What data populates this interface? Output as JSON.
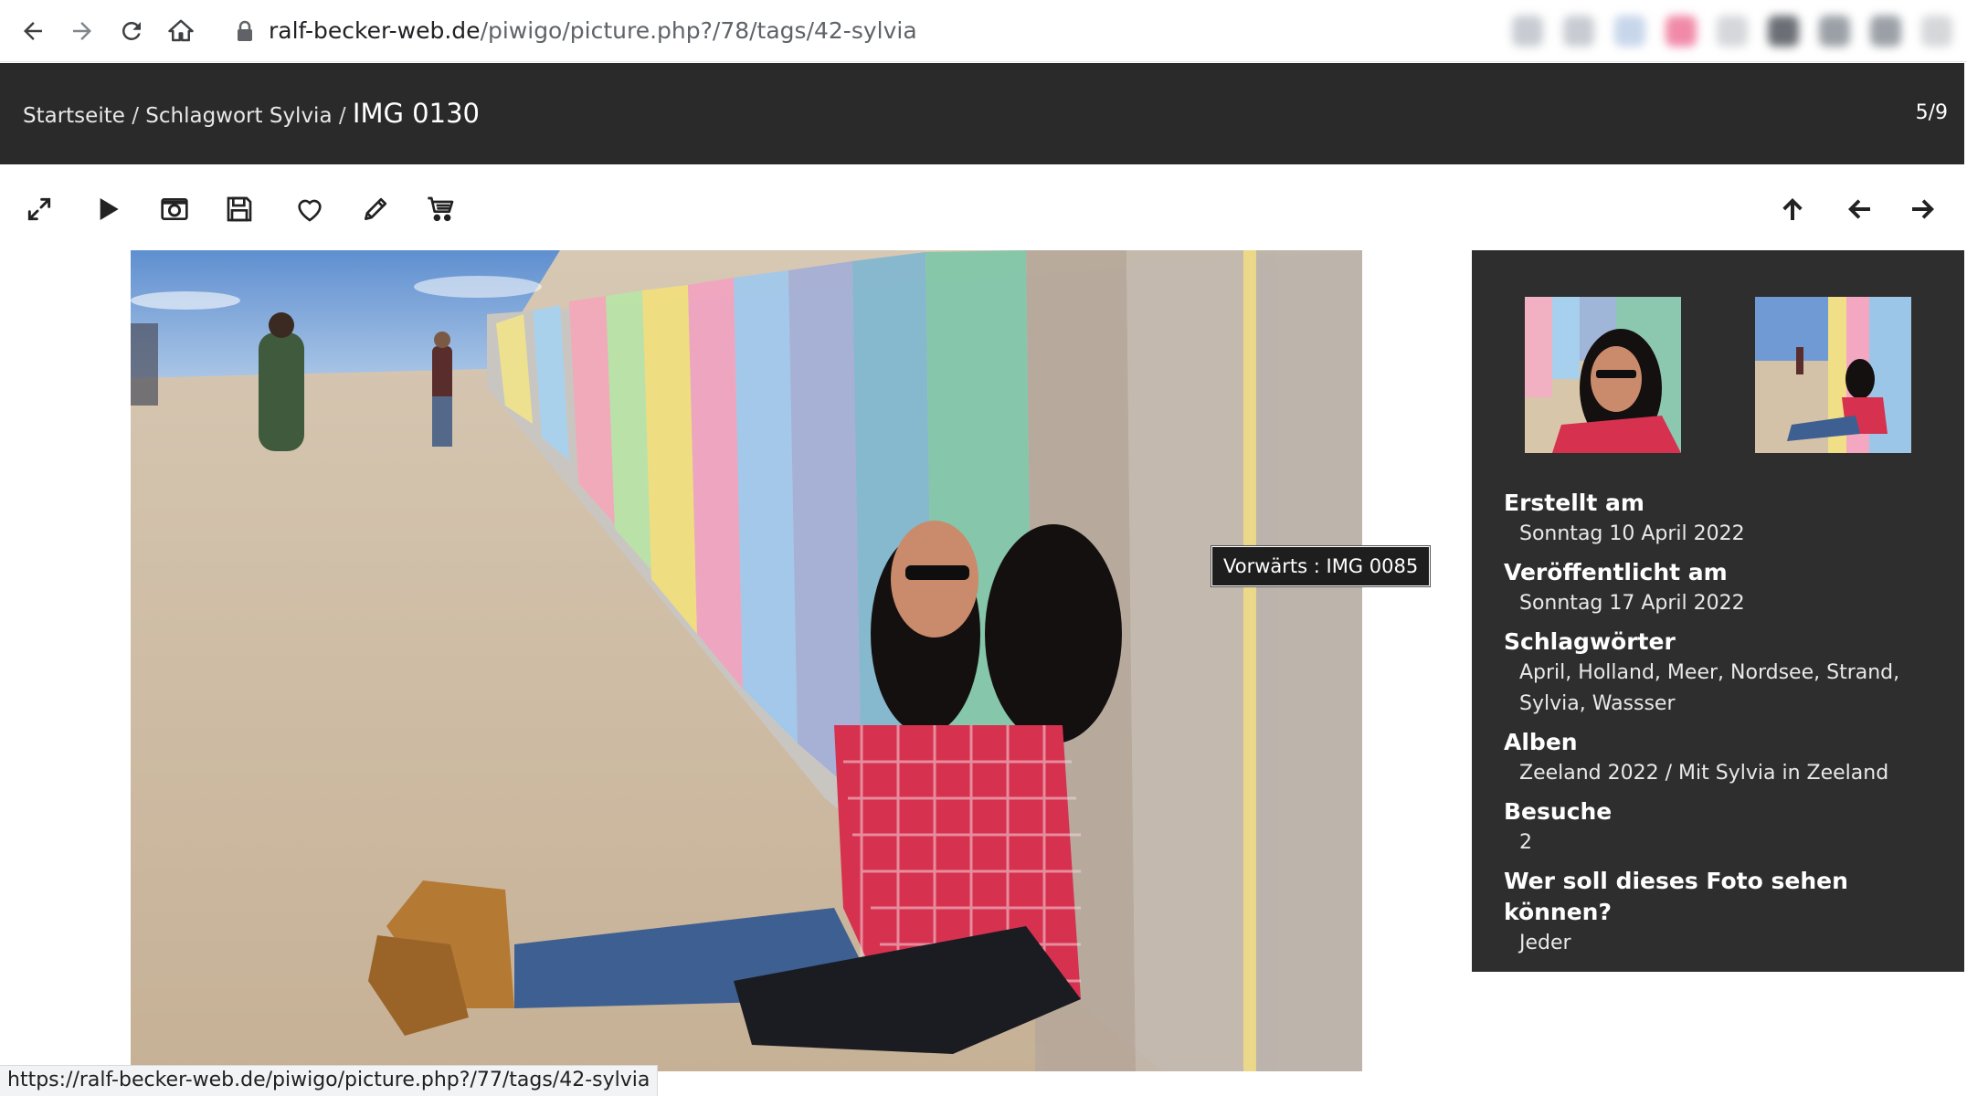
{
  "browser": {
    "url_host": "ralf-becker-web.de",
    "url_path": "/piwigo/picture.php?/78/tags/42-sylvia",
    "icons": [
      "back-icon",
      "forward-icon",
      "reload-icon",
      "home-icon",
      "lock-icon"
    ]
  },
  "header": {
    "breadcrumb_home": "Startseite",
    "separator": "/",
    "breadcrumb_tag": "Schlagwort Sylvia",
    "title": "IMG 0130",
    "counter": "5/9"
  },
  "toolbar": {
    "left_icons": [
      "fullscreen-icon",
      "slideshow-play-icon",
      "metadata-camera-icon",
      "download-save-icon",
      "favorite-heart-icon",
      "edit-pencil-icon",
      "cart-icon"
    ],
    "right_icons": [
      "thumbnails-up-arrow-icon",
      "previous-arrow-icon",
      "next-arrow-icon"
    ]
  },
  "tooltip": {
    "text": "Vorwärts : IMG 0085"
  },
  "info": {
    "created_label": "Erstellt am",
    "created_value": "Sonntag 10 April 2022",
    "posted_label": "Veröffentlicht am",
    "posted_value": "Sonntag 17 April 2022",
    "tags_label": "Schlagwörter",
    "tags": [
      "April",
      "Holland",
      "Meer",
      "Nordsee",
      "Strand",
      "Sylvia",
      "Wassser"
    ],
    "albums_label": "Alben",
    "album_parent": "Zeeland 2022",
    "album_child": "Mit Sylvia in Zeeland",
    "visits_label": "Besuche",
    "visits_value": "2",
    "privacy_label": "Wer soll dieses Foto sehen können?",
    "privacy_value": "Jeder"
  },
  "statusbar": {
    "url": "https://ralf-becker-web.de/piwigo/picture.php?/77/tags/42-sylvia"
  }
}
